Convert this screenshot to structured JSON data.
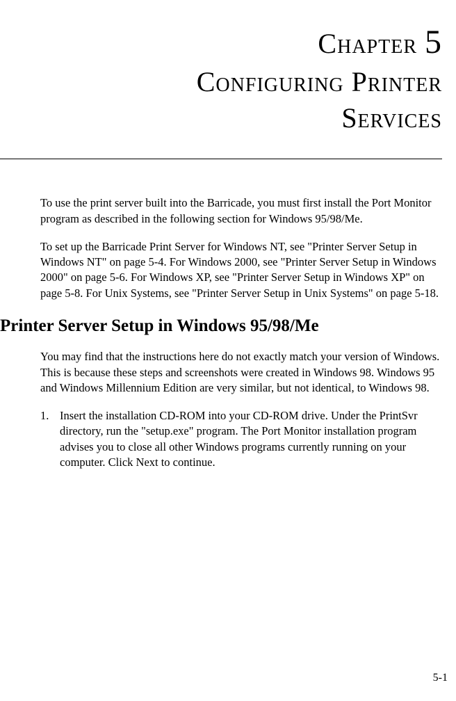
{
  "chapter": {
    "label": "Chapter",
    "number": "5",
    "title_line1": "Configuring Printer",
    "title_line2": "Services"
  },
  "paragraphs": {
    "p1": "To use the print server built into the Barricade, you must first install the Port Monitor program as described in the following section for Windows 95/98/Me.",
    "p2": "To set up the Barricade Print Server for Windows NT, see \"Printer Server Setup in Windows NT\" on page 5-4. For Windows 2000, see \"Printer Server Setup in Windows 2000\" on page 5-6. For Windows XP, see \"Printer Server Setup in Windows XP\" on page 5-8. For Unix Systems, see \"Printer Server Setup in Unix Systems\" on page 5-18."
  },
  "section": {
    "heading": "Printer Server Setup in Windows 95/98/Me",
    "p1": "You may find that the instructions here do not exactly match your version of Windows. This is because these steps and screenshots were created in Windows 98. Windows 95 and Windows Millennium Edition are very similar, but not identical, to Windows 98.",
    "list": {
      "item1_number": "1.",
      "item1_text": "Insert the installation CD-ROM into your CD-ROM drive. Under the PrintSvr directory, run the \"setup.exe\" program. The Port Monitor installation program advises you to close all other Windows programs currently running on your computer. Click Next to continue."
    }
  },
  "page_number": "5-1"
}
